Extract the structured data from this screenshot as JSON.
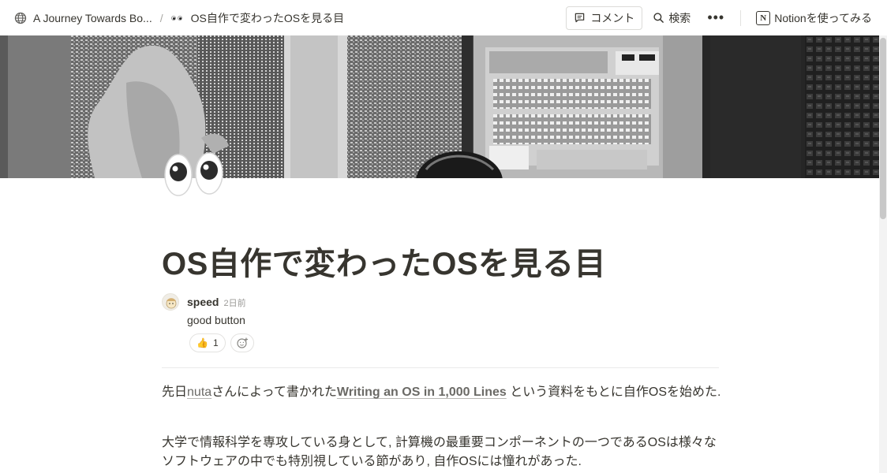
{
  "topbar": {
    "workspace_crumb": "A Journey Towards Bo...",
    "separator": "/",
    "page_crumb": "OS自作で変わったOSを見る目",
    "comment_label": "コメント",
    "search_label": "検索",
    "more_label": "•••",
    "notion_label": "Notionを使ってみる",
    "notion_logo": "N",
    "icons": [
      "globe-icon",
      "eyes-icon",
      "comment-icon",
      "search-icon",
      "more-icon",
      "notion-logo-icon"
    ]
  },
  "page": {
    "title": "OS自作で変わったOSを見る目",
    "icon": "eyes-emoji"
  },
  "comment": {
    "author": "speed",
    "time": "2日前",
    "body": "good button",
    "reaction_emoji": "👍",
    "reaction_count": "1"
  },
  "content": {
    "p1_pre": "先日",
    "p1_link1": "nuta",
    "p1_mid": "さんによって書かれた",
    "p1_link2": "Writing an OS in 1,000 Lines",
    "p1_post": " という資料をもとに自作OSを始めた.",
    "p2_line1": "大学で情報科学を専攻している身として, 計算機の最重要コンポーネントの一つであるOSは様々な",
    "p2_line2": "ソフトウェアの中でも特別視している節があり, 自作OSには憧れがあった."
  }
}
